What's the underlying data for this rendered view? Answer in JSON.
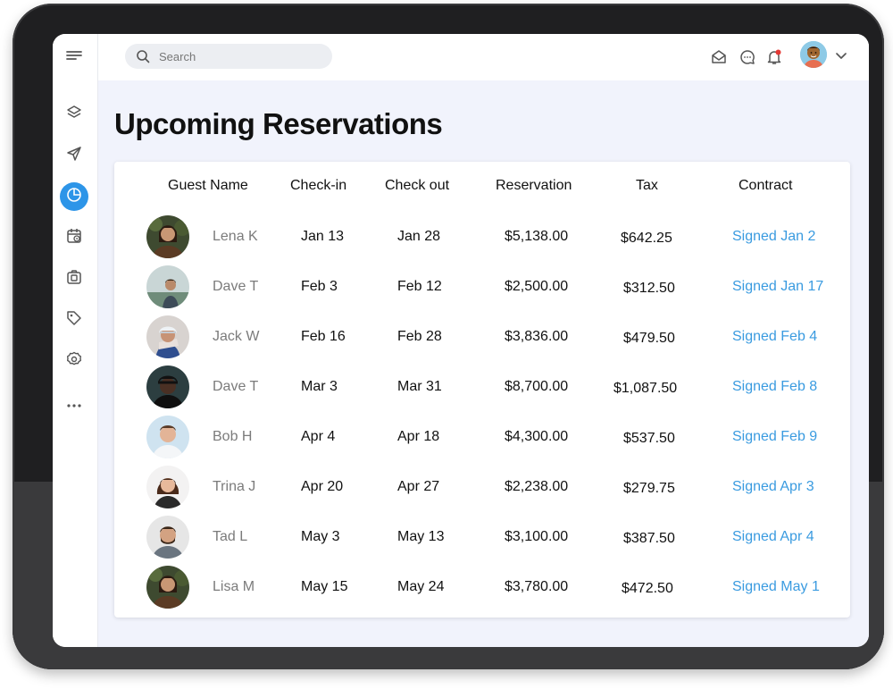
{
  "search": {
    "placeholder": "Search"
  },
  "page": {
    "title": "Upcoming Reservations"
  },
  "table": {
    "headers": {
      "guest": "Guest Name",
      "checkin": "Check-in",
      "checkout": "Check out",
      "reservation": "Reservation",
      "tax": "Tax",
      "contract": "Contract"
    },
    "rows": [
      {
        "name": "Lena K",
        "checkin": "Jan 13",
        "checkout": "Jan 28",
        "reservation": "$5,138.00",
        "tax": "$642.25",
        "contract": "Signed Jan 2"
      },
      {
        "name": "Dave T",
        "checkin": "Feb 3",
        "checkout": "Feb 12",
        "reservation": "$2,500.00",
        "tax": "$312.50",
        "contract": "Signed Jan 17"
      },
      {
        "name": "Jack W",
        "checkin": "Feb 16",
        "checkout": "Feb 28",
        "reservation": "$3,836.00",
        "tax": "$479.50",
        "contract": "Signed Feb 4"
      },
      {
        "name": "Dave T",
        "checkin": "Mar 3",
        "checkout": "Mar 31",
        "reservation": "$8,700.00",
        "tax": "$1,087.50",
        "contract": "Signed Feb 8"
      },
      {
        "name": "Bob H",
        "checkin": "Apr 4",
        "checkout": "Apr 18",
        "reservation": "$4,300.00",
        "tax": "$537.50",
        "contract": "Signed Feb 9"
      },
      {
        "name": "Trina J",
        "checkin": "Apr 20",
        "checkout": "Apr 27",
        "reservation": "$2,238.00",
        "tax": "$279.75",
        "contract": "Signed Apr 3"
      },
      {
        "name": "Tad L",
        "checkin": "May 3",
        "checkout": "May 13",
        "reservation": "$3,100.00",
        "tax": "$387.50",
        "contract": "Signed Apr 4"
      },
      {
        "name": "Lisa M",
        "checkin": "May 15",
        "checkout": "May 24",
        "reservation": "$3,780.00",
        "tax": "$472.50",
        "contract": "Signed May 1"
      }
    ]
  },
  "colors": {
    "accent": "#2d95e8",
    "contract_link": "#3a9be0",
    "notification_dot": "#e53935",
    "content_bg": "#f1f3fc"
  },
  "icons": {
    "sidebar": [
      "menu-icon",
      "layers-icon",
      "send-icon",
      "pie-chart-icon",
      "calendar-clock-icon",
      "camera-icon",
      "tag-icon",
      "settings-icon",
      "more-icon"
    ],
    "topbar": [
      "search-icon",
      "mail-icon",
      "chat-icon",
      "bell-icon",
      "chevron-down-icon"
    ]
  }
}
